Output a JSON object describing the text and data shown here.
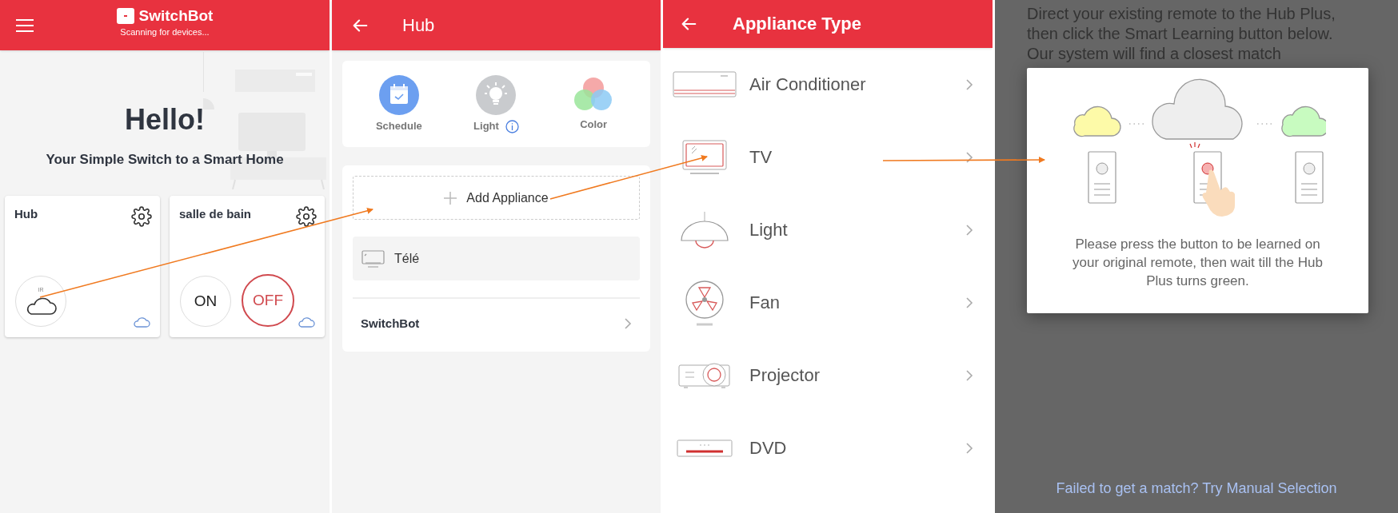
{
  "home": {
    "app_name": "SwitchBot",
    "status": "Scanning for devices...",
    "greeting": "Hello!",
    "tagline": "Your Simple Switch to a Smart Home",
    "devices": [
      {
        "kind": "hub",
        "name": "Hub",
        "badge": "IR"
      },
      {
        "kind": "switch",
        "name": "salle de bain",
        "on_label": "ON",
        "off_label": "OFF"
      }
    ]
  },
  "hub": {
    "title": "Hub",
    "features": [
      {
        "kind": "schedule",
        "label": "Schedule",
        "info": false
      },
      {
        "kind": "light",
        "label": "Light",
        "info": true
      },
      {
        "kind": "color",
        "label": "Color",
        "info": false
      }
    ],
    "add_label": "Add Appliance",
    "appliances": [
      {
        "name": "Télé"
      }
    ],
    "sections": [
      {
        "label": "SwitchBot"
      }
    ]
  },
  "appliance_type": {
    "title": "Appliance Type",
    "items": [
      {
        "kind": "ac",
        "label": "Air Conditioner"
      },
      {
        "kind": "tv",
        "label": "TV"
      },
      {
        "kind": "light",
        "label": "Light"
      },
      {
        "kind": "fan",
        "label": "Fan"
      },
      {
        "kind": "projector",
        "label": "Projector"
      },
      {
        "kind": "dvd",
        "label": "DVD"
      }
    ]
  },
  "learning": {
    "instructions": "Direct your existing remote to the Hub Plus, then click the Smart Learning button below. Our system will find a closest match",
    "dialog": {
      "message": "Please press the button to be learned on your original remote, then wait till the Hub Plus turns green."
    },
    "link": "Failed to get a match? Try Manual Selection"
  }
}
